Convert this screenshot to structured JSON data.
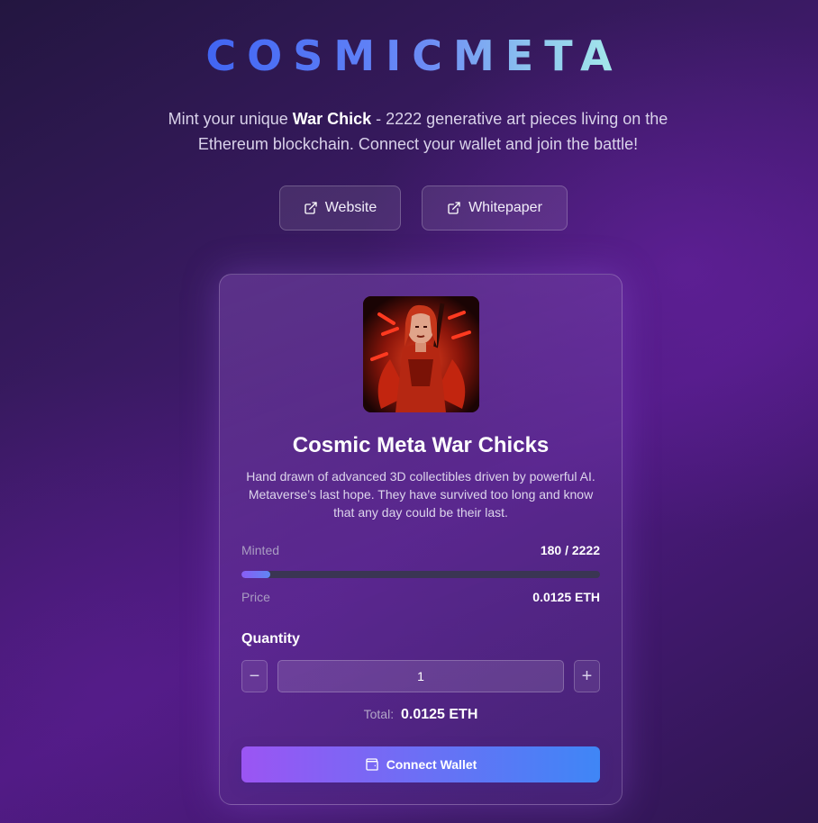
{
  "brand": {
    "logo_text": "COSMICMETA",
    "accent_start": "#3f63f2",
    "accent_end": "#a6ecea"
  },
  "tagline": {
    "prefix": "Mint your unique ",
    "highlight": "War Chick",
    "suffix": " - 2222 generative art pieces living on the Ethereum blockchain. Connect your wallet and join the battle!"
  },
  "links": {
    "website_label": "Website",
    "whitepaper_label": "Whitepaper",
    "icon": "external-link-icon"
  },
  "collection": {
    "image_icon": "war-chick-artwork",
    "title": "Cosmic Meta War Chicks",
    "description": "Hand drawn of advanced 3D collectibles driven by powerful AI. Metaverse’s last hope. They have survived too long and know that any day could be their last."
  },
  "stats": {
    "minted_label": "Minted",
    "minted_value": "180 / 2222",
    "minted_count": 180,
    "max_supply": 2222,
    "price_label": "Price",
    "price_value": "0.0125 ETH"
  },
  "quantity": {
    "label": "Quantity",
    "value": "1",
    "minus_symbol": "−",
    "plus_symbol": "+"
  },
  "total": {
    "label": "Total:",
    "value": "0.0125 ETH"
  },
  "wallet": {
    "button_label": "Connect Wallet",
    "icon": "wallet-icon",
    "gradient_start": "#9b55f3",
    "gradient_end": "#3f86f6"
  }
}
